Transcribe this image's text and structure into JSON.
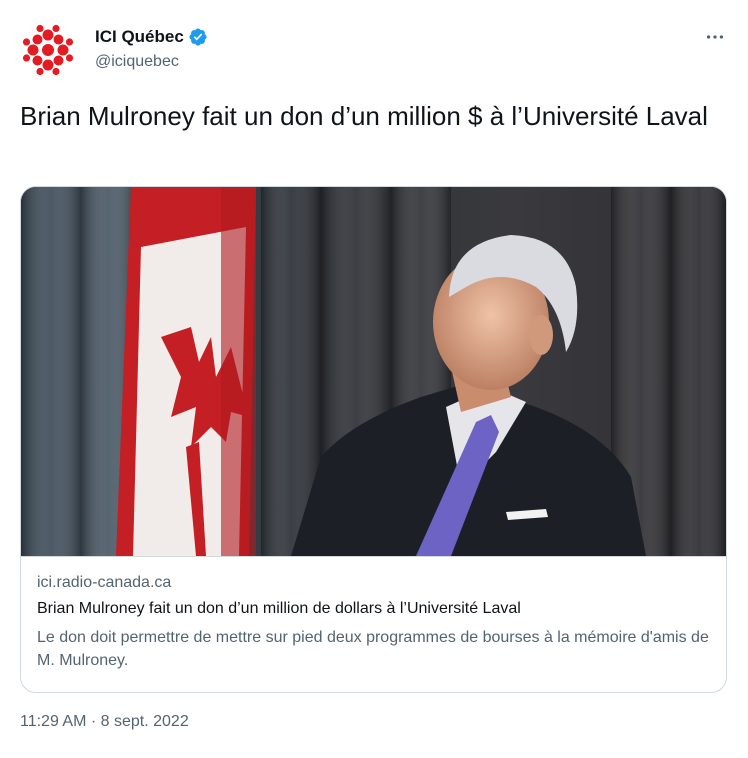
{
  "author": {
    "display_name": "ICI Québec",
    "handle": "@iciquebec",
    "verified": true,
    "avatar_icon": "radio-canada-logo-icon",
    "brand_color": "#e31b23"
  },
  "tweet": {
    "text": "Brian Mulroney fait un don d’un million $ à l’Université Laval"
  },
  "card": {
    "domain": "ici.radio-canada.ca",
    "title": "Brian Mulroney fait un don d’un million de dollars à l’Université Laval",
    "description": "Le don doit permettre de mettre sur pied deux programmes de bourses à la mémoire d'amis de M. Mulroney."
  },
  "meta": {
    "time": "11:29 AM",
    "separator": " · ",
    "date": "8 sept. 2022"
  },
  "icons": {
    "more": "more-options-icon",
    "verified": "verified-badge-icon"
  },
  "colors": {
    "accent": "#1d9bf0",
    "text_primary": "#0f1419",
    "text_secondary": "#536471",
    "border": "#cfd9de"
  }
}
